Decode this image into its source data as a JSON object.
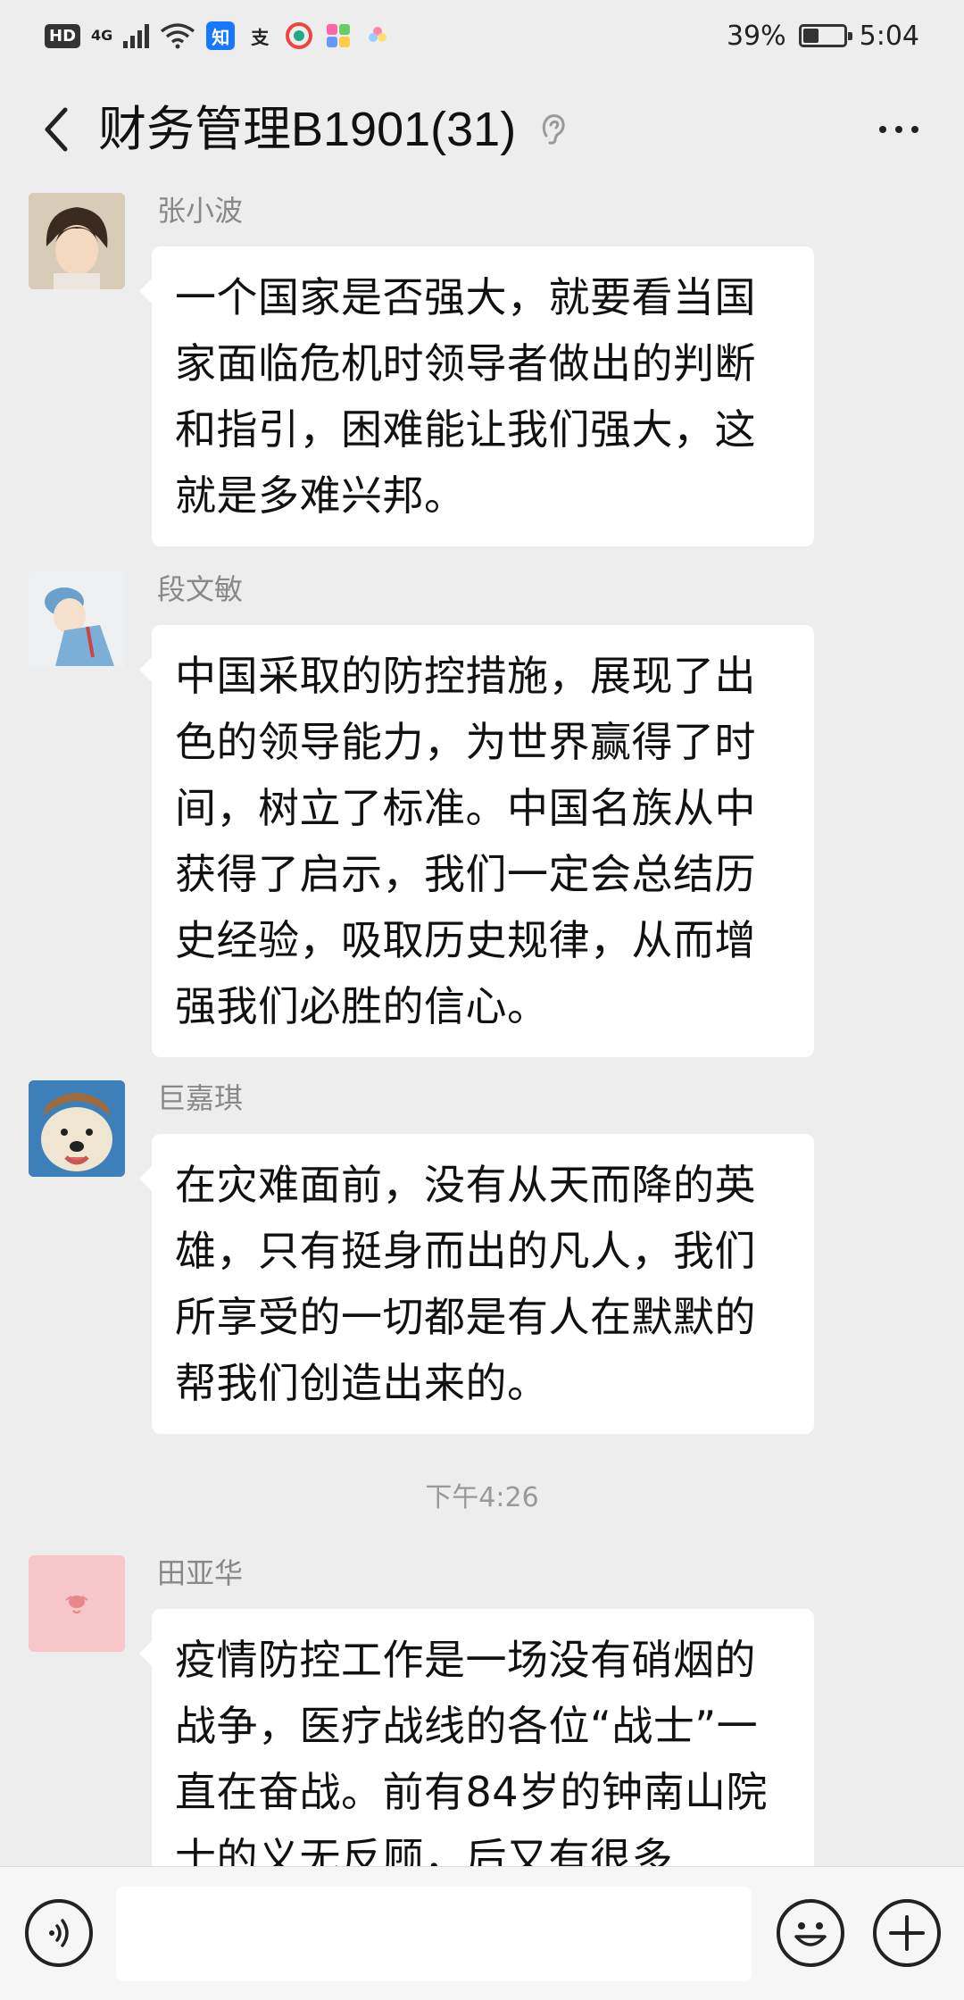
{
  "status_bar": {
    "hd_badge": "HD",
    "network": "4G",
    "app_icons": [
      "知",
      "支"
    ],
    "battery_percent": "39%",
    "battery_level": 0.39,
    "time": "5:04"
  },
  "header": {
    "title": "财务管理B1901(31)",
    "back_icon": "chevron-left-icon",
    "muted_icon": "ear-icon",
    "more_icon": "more-dots-icon"
  },
  "messages": [
    {
      "sender": "张小波",
      "text": "一个国家是否强大，就要看当国家面临危机时领导者做出的判断和指引，困难能让我们强大，这就是多难兴邦。"
    },
    {
      "sender": "段文敏",
      "text": "中国采取的防控措施，展现了出色的领导能力，为世界赢得了时间，树立了标准。中国名族从中获得了启示，我们一定会总结历史经验，吸取历史规律，从而增强我们必胜的信心。"
    },
    {
      "sender": "巨嘉琪",
      "text": "在灾难面前，没有从天而降的英雄，只有挺身而出的凡人，我们所享受的一切都是有人在默默的帮我们创造出来的。"
    },
    {
      "sender": "田亚华",
      "text": "疫情防控工作是一场没有硝烟的战争，医疗战线的各位“战士”一直在奋战。前有84岁的钟南山院士的义无反顾，后又有很多"
    }
  ],
  "time_separator": "下午4:26",
  "input_bar": {
    "text_value": "",
    "voice_icon": "voice-icon",
    "emoji_icon": "emoji-icon",
    "plus_icon": "plus-icon"
  }
}
